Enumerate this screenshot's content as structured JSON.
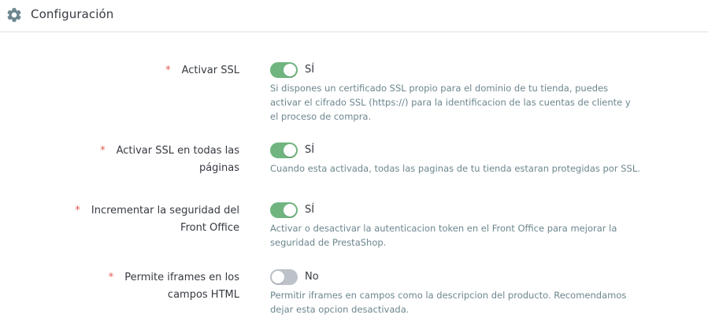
{
  "header": {
    "title": "Configuración",
    "icon": "gear-icon"
  },
  "colors": {
    "toggle_on": "#70b580",
    "toggle_off": "#bcc2c8",
    "required": "#e45a4f"
  },
  "settings": [
    {
      "label_line1": "Activar SSL",
      "label_line2": "",
      "required_mark": "*",
      "enabled": true,
      "state_label": "SÍ",
      "help": "Si dispones un certificado SSL propio para el dominio de tu tienda, puedes activar el cifrado SSL (https://) para la identificacion de las cuentas de cliente y el proceso de compra."
    },
    {
      "label_line1": "Activar SSL en todas las",
      "label_line2": "páginas",
      "required_mark": "*",
      "enabled": true,
      "state_label": "SÍ",
      "help": "Cuando esta activada, todas las paginas de tu tienda estaran protegidas por SSL."
    },
    {
      "label_line1": "Incrementar la seguridad del",
      "label_line2": "Front Office",
      "required_mark": "*",
      "enabled": true,
      "state_label": "SÍ",
      "help": "Activar o desactivar la autenticacion token en el Front Office para mejorar la seguridad de PrestaShop."
    },
    {
      "label_line1": "Permite iframes en los",
      "label_line2": "campos HTML",
      "required_mark": "*",
      "enabled": false,
      "state_label": "No",
      "help": "Permitir iframes en campos como la descripcion del producto. Recomendamos dejar esta opcion desactivada."
    }
  ]
}
